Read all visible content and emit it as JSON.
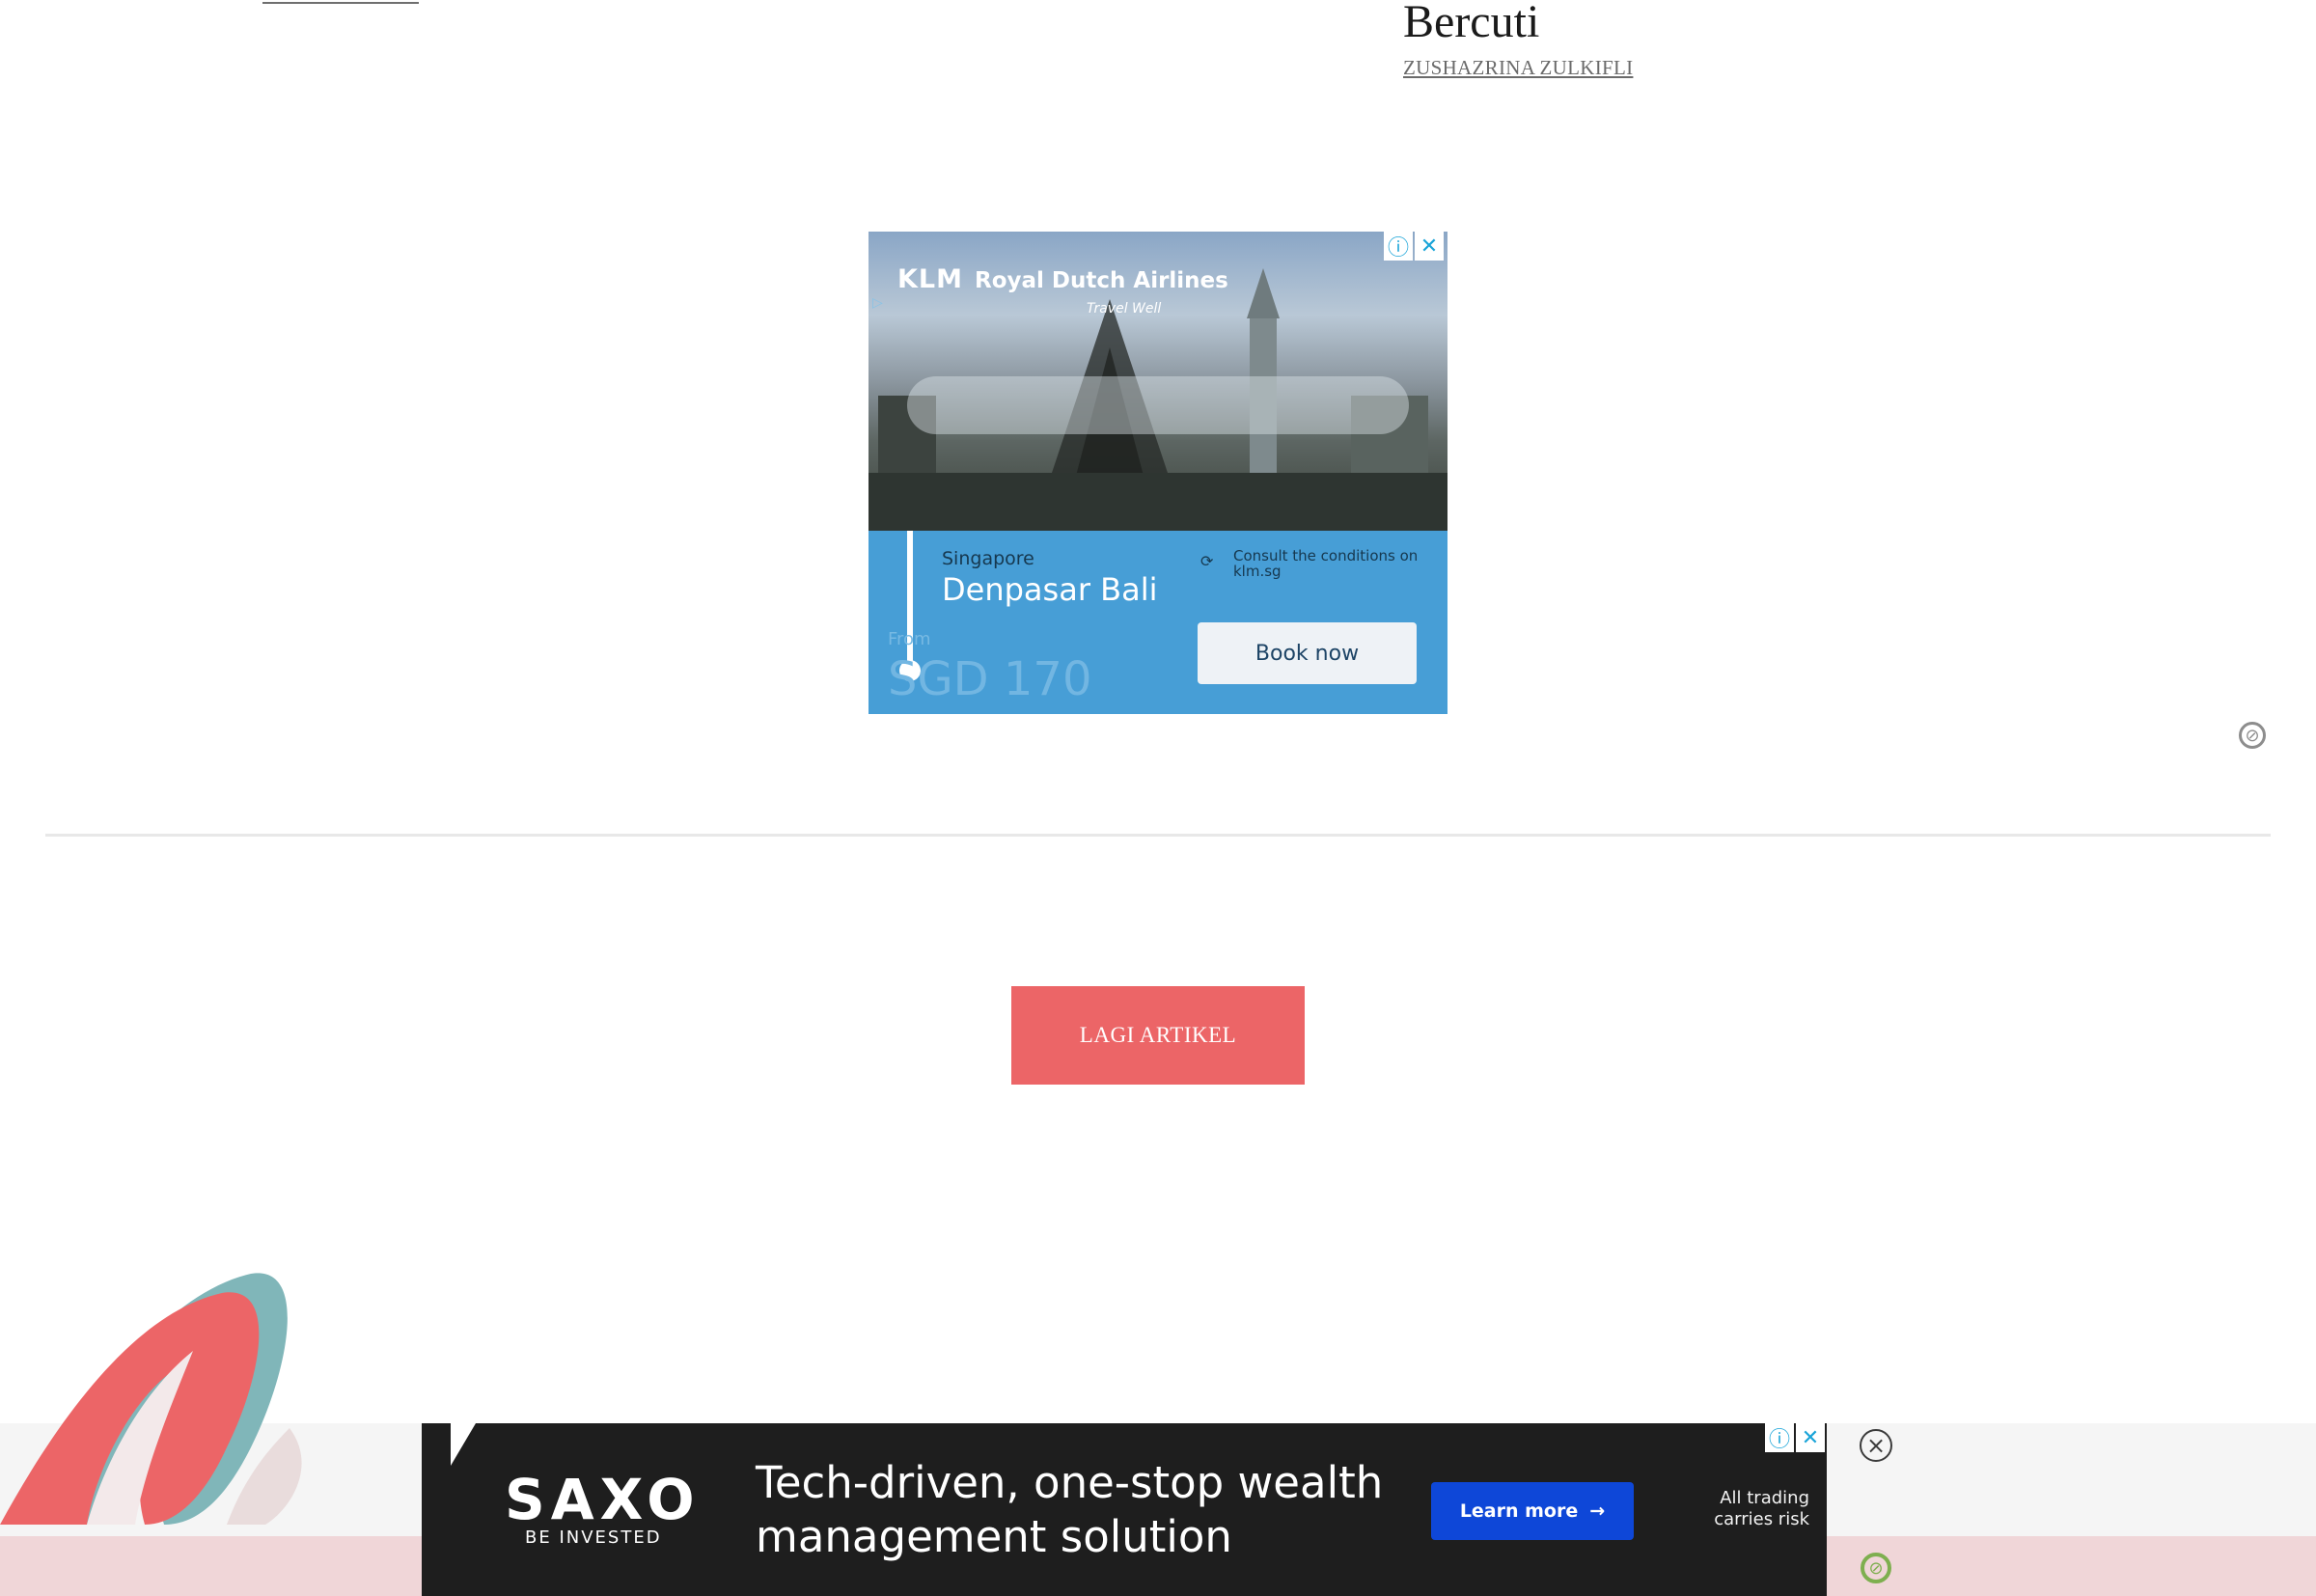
{
  "article": {
    "title": "Bercuti",
    "author": "ZUSHAZRINA ZULKIFLI"
  },
  "klm_ad": {
    "brand_logo": "KLM",
    "brand_name": "Royal Dutch Airlines",
    "tagline": "Travel Well",
    "origin": "Singapore",
    "destination": "Denpasar Bali",
    "from_label": "From",
    "price": "SGD 170",
    "conditions": "Consult the conditions on klm.sg",
    "cta": "Book now",
    "icons": [
      "info-icon",
      "close-icon",
      "refresh-icon",
      "ad-marker-icon"
    ]
  },
  "more_button": {
    "label": "LAGI ARTIKEL"
  },
  "saxo_ad": {
    "logo": "SAXO",
    "subtitle": "BE INVESTED",
    "headline": "Tech-driven, one-stop wealth management solution",
    "cta": "Learn more",
    "disclaimer": "All trading carries risk",
    "icons": [
      "info-icon",
      "close-icon",
      "arrow-right-icon"
    ]
  },
  "colors": {
    "brand_red": "#ec6567",
    "klm_blue": "#479ed6",
    "saxo_blue": "#0e47d8",
    "saxo_bg": "#1e1e1e",
    "sticky_pink": "#f0d6d8"
  }
}
